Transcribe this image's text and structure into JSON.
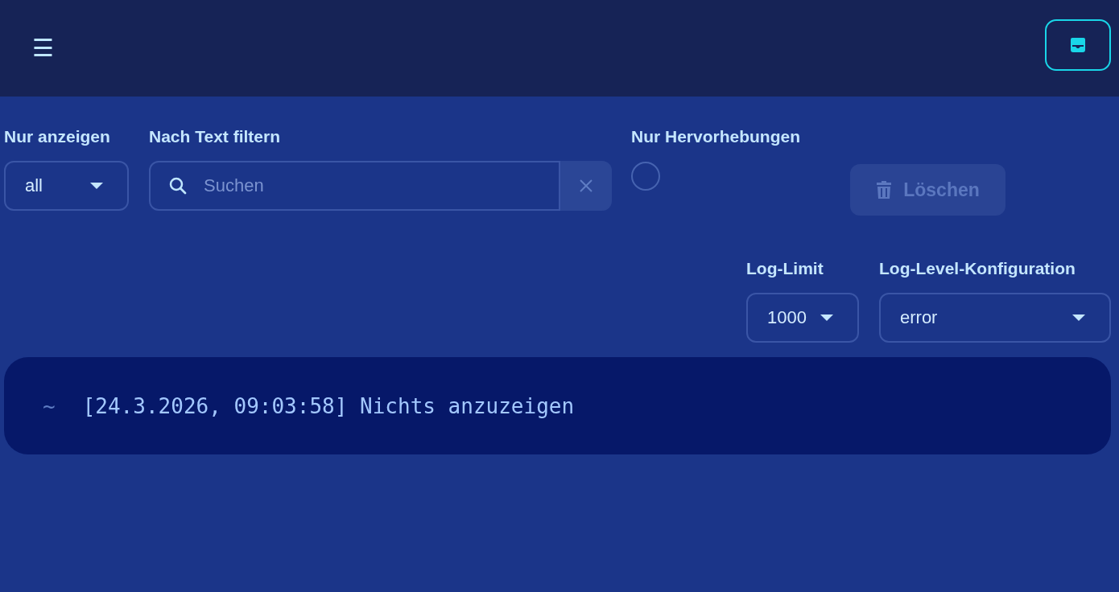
{
  "header": {
    "menu_icon": "☰"
  },
  "filters": {
    "show_only": {
      "label": "Nur anzeigen",
      "value": "all"
    },
    "text_filter": {
      "label": "Nach Text filtern",
      "placeholder": "Suchen"
    },
    "highlights_only": {
      "label": "Nur Hervorhebungen",
      "checked": false
    },
    "delete_button": {
      "label": "Löschen",
      "disabled": true
    }
  },
  "settings": [
    {
      "label": "Log-Limit",
      "value": "1000",
      "kind": "narrow"
    },
    {
      "label": "Log-Level-Konfiguration",
      "value": "error",
      "kind": "wide"
    }
  ],
  "log": [
    {
      "marker": "~",
      "text": "[24.3.2026, 09:03:58] Nichts anzuzeigen"
    }
  ]
}
